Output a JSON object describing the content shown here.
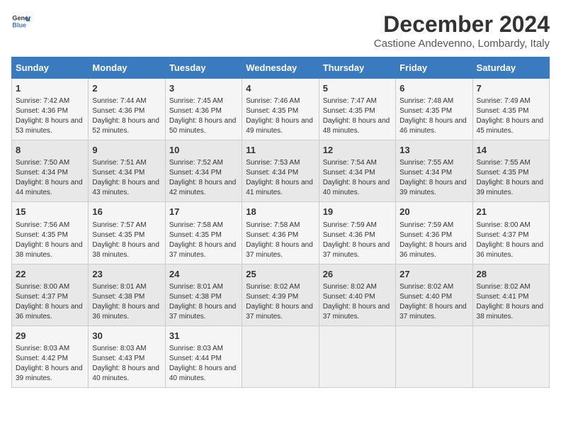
{
  "header": {
    "logo_line1": "General",
    "logo_line2": "Blue",
    "title": "December 2024",
    "subtitle": "Castione Andevenno, Lombardy, Italy"
  },
  "days_of_week": [
    "Sunday",
    "Monday",
    "Tuesday",
    "Wednesday",
    "Thursday",
    "Friday",
    "Saturday"
  ],
  "weeks": [
    [
      {
        "day": "1",
        "sunrise": "Sunrise: 7:42 AM",
        "sunset": "Sunset: 4:36 PM",
        "daylight": "Daylight: 8 hours and 53 minutes."
      },
      {
        "day": "2",
        "sunrise": "Sunrise: 7:44 AM",
        "sunset": "Sunset: 4:36 PM",
        "daylight": "Daylight: 8 hours and 52 minutes."
      },
      {
        "day": "3",
        "sunrise": "Sunrise: 7:45 AM",
        "sunset": "Sunset: 4:36 PM",
        "daylight": "Daylight: 8 hours and 50 minutes."
      },
      {
        "day": "4",
        "sunrise": "Sunrise: 7:46 AM",
        "sunset": "Sunset: 4:35 PM",
        "daylight": "Daylight: 8 hours and 49 minutes."
      },
      {
        "day": "5",
        "sunrise": "Sunrise: 7:47 AM",
        "sunset": "Sunset: 4:35 PM",
        "daylight": "Daylight: 8 hours and 48 minutes."
      },
      {
        "day": "6",
        "sunrise": "Sunrise: 7:48 AM",
        "sunset": "Sunset: 4:35 PM",
        "daylight": "Daylight: 8 hours and 46 minutes."
      },
      {
        "day": "7",
        "sunrise": "Sunrise: 7:49 AM",
        "sunset": "Sunset: 4:35 PM",
        "daylight": "Daylight: 8 hours and 45 minutes."
      }
    ],
    [
      {
        "day": "8",
        "sunrise": "Sunrise: 7:50 AM",
        "sunset": "Sunset: 4:34 PM",
        "daylight": "Daylight: 8 hours and 44 minutes."
      },
      {
        "day": "9",
        "sunrise": "Sunrise: 7:51 AM",
        "sunset": "Sunset: 4:34 PM",
        "daylight": "Daylight: 8 hours and 43 minutes."
      },
      {
        "day": "10",
        "sunrise": "Sunrise: 7:52 AM",
        "sunset": "Sunset: 4:34 PM",
        "daylight": "Daylight: 8 hours and 42 minutes."
      },
      {
        "day": "11",
        "sunrise": "Sunrise: 7:53 AM",
        "sunset": "Sunset: 4:34 PM",
        "daylight": "Daylight: 8 hours and 41 minutes."
      },
      {
        "day": "12",
        "sunrise": "Sunrise: 7:54 AM",
        "sunset": "Sunset: 4:34 PM",
        "daylight": "Daylight: 8 hours and 40 minutes."
      },
      {
        "day": "13",
        "sunrise": "Sunrise: 7:55 AM",
        "sunset": "Sunset: 4:34 PM",
        "daylight": "Daylight: 8 hours and 39 minutes."
      },
      {
        "day": "14",
        "sunrise": "Sunrise: 7:55 AM",
        "sunset": "Sunset: 4:35 PM",
        "daylight": "Daylight: 8 hours and 39 minutes."
      }
    ],
    [
      {
        "day": "15",
        "sunrise": "Sunrise: 7:56 AM",
        "sunset": "Sunset: 4:35 PM",
        "daylight": "Daylight: 8 hours and 38 minutes."
      },
      {
        "day": "16",
        "sunrise": "Sunrise: 7:57 AM",
        "sunset": "Sunset: 4:35 PM",
        "daylight": "Daylight: 8 hours and 38 minutes."
      },
      {
        "day": "17",
        "sunrise": "Sunrise: 7:58 AM",
        "sunset": "Sunset: 4:35 PM",
        "daylight": "Daylight: 8 hours and 37 minutes."
      },
      {
        "day": "18",
        "sunrise": "Sunrise: 7:58 AM",
        "sunset": "Sunset: 4:36 PM",
        "daylight": "Daylight: 8 hours and 37 minutes."
      },
      {
        "day": "19",
        "sunrise": "Sunrise: 7:59 AM",
        "sunset": "Sunset: 4:36 PM",
        "daylight": "Daylight: 8 hours and 37 minutes."
      },
      {
        "day": "20",
        "sunrise": "Sunrise: 7:59 AM",
        "sunset": "Sunset: 4:36 PM",
        "daylight": "Daylight: 8 hours and 36 minutes."
      },
      {
        "day": "21",
        "sunrise": "Sunrise: 8:00 AM",
        "sunset": "Sunset: 4:37 PM",
        "daylight": "Daylight: 8 hours and 36 minutes."
      }
    ],
    [
      {
        "day": "22",
        "sunrise": "Sunrise: 8:00 AM",
        "sunset": "Sunset: 4:37 PM",
        "daylight": "Daylight: 8 hours and 36 minutes."
      },
      {
        "day": "23",
        "sunrise": "Sunrise: 8:01 AM",
        "sunset": "Sunset: 4:38 PM",
        "daylight": "Daylight: 8 hours and 36 minutes."
      },
      {
        "day": "24",
        "sunrise": "Sunrise: 8:01 AM",
        "sunset": "Sunset: 4:38 PM",
        "daylight": "Daylight: 8 hours and 37 minutes."
      },
      {
        "day": "25",
        "sunrise": "Sunrise: 8:02 AM",
        "sunset": "Sunset: 4:39 PM",
        "daylight": "Daylight: 8 hours and 37 minutes."
      },
      {
        "day": "26",
        "sunrise": "Sunrise: 8:02 AM",
        "sunset": "Sunset: 4:40 PM",
        "daylight": "Daylight: 8 hours and 37 minutes."
      },
      {
        "day": "27",
        "sunrise": "Sunrise: 8:02 AM",
        "sunset": "Sunset: 4:40 PM",
        "daylight": "Daylight: 8 hours and 37 minutes."
      },
      {
        "day": "28",
        "sunrise": "Sunrise: 8:02 AM",
        "sunset": "Sunset: 4:41 PM",
        "daylight": "Daylight: 8 hours and 38 minutes."
      }
    ],
    [
      {
        "day": "29",
        "sunrise": "Sunrise: 8:03 AM",
        "sunset": "Sunset: 4:42 PM",
        "daylight": "Daylight: 8 hours and 39 minutes."
      },
      {
        "day": "30",
        "sunrise": "Sunrise: 8:03 AM",
        "sunset": "Sunset: 4:43 PM",
        "daylight": "Daylight: 8 hours and 40 minutes."
      },
      {
        "day": "31",
        "sunrise": "Sunrise: 8:03 AM",
        "sunset": "Sunset: 4:44 PM",
        "daylight": "Daylight: 8 hours and 40 minutes."
      },
      null,
      null,
      null,
      null
    ]
  ]
}
